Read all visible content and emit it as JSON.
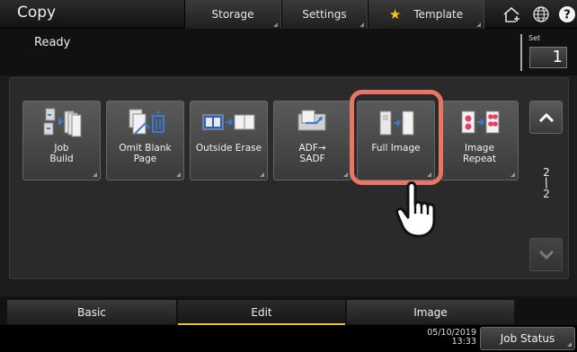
{
  "header": {
    "title": "Copy",
    "buttons": {
      "storage": "Storage",
      "settings": "Settings",
      "template": "Template"
    }
  },
  "status": {
    "text": "Ready",
    "set_label": "Set",
    "set_value": "1"
  },
  "tiles": [
    {
      "label": "Job\nBuild",
      "icon": "job-build-icon"
    },
    {
      "label": "Omit Blank\nPage",
      "icon": "omit-blank-page-icon"
    },
    {
      "label": "Outside Erase",
      "icon": "outside-erase-icon"
    },
    {
      "label": "ADF→\nSADF",
      "icon": "adf-sadf-icon"
    },
    {
      "label": "Full Image",
      "icon": "full-image-icon"
    },
    {
      "label": "Image\nRepeat",
      "icon": "image-repeat-icon"
    }
  ],
  "pager": {
    "current": "2",
    "total": "2"
  },
  "tabs": {
    "basic": "Basic",
    "edit": "Edit",
    "image": "Image"
  },
  "footer": {
    "date": "05/10/2019",
    "time": "13:33",
    "job_status": "Job Status"
  },
  "colors": {
    "highlight": "#e87565",
    "accent_tab": "#e0c040",
    "star": "#f5c518"
  }
}
